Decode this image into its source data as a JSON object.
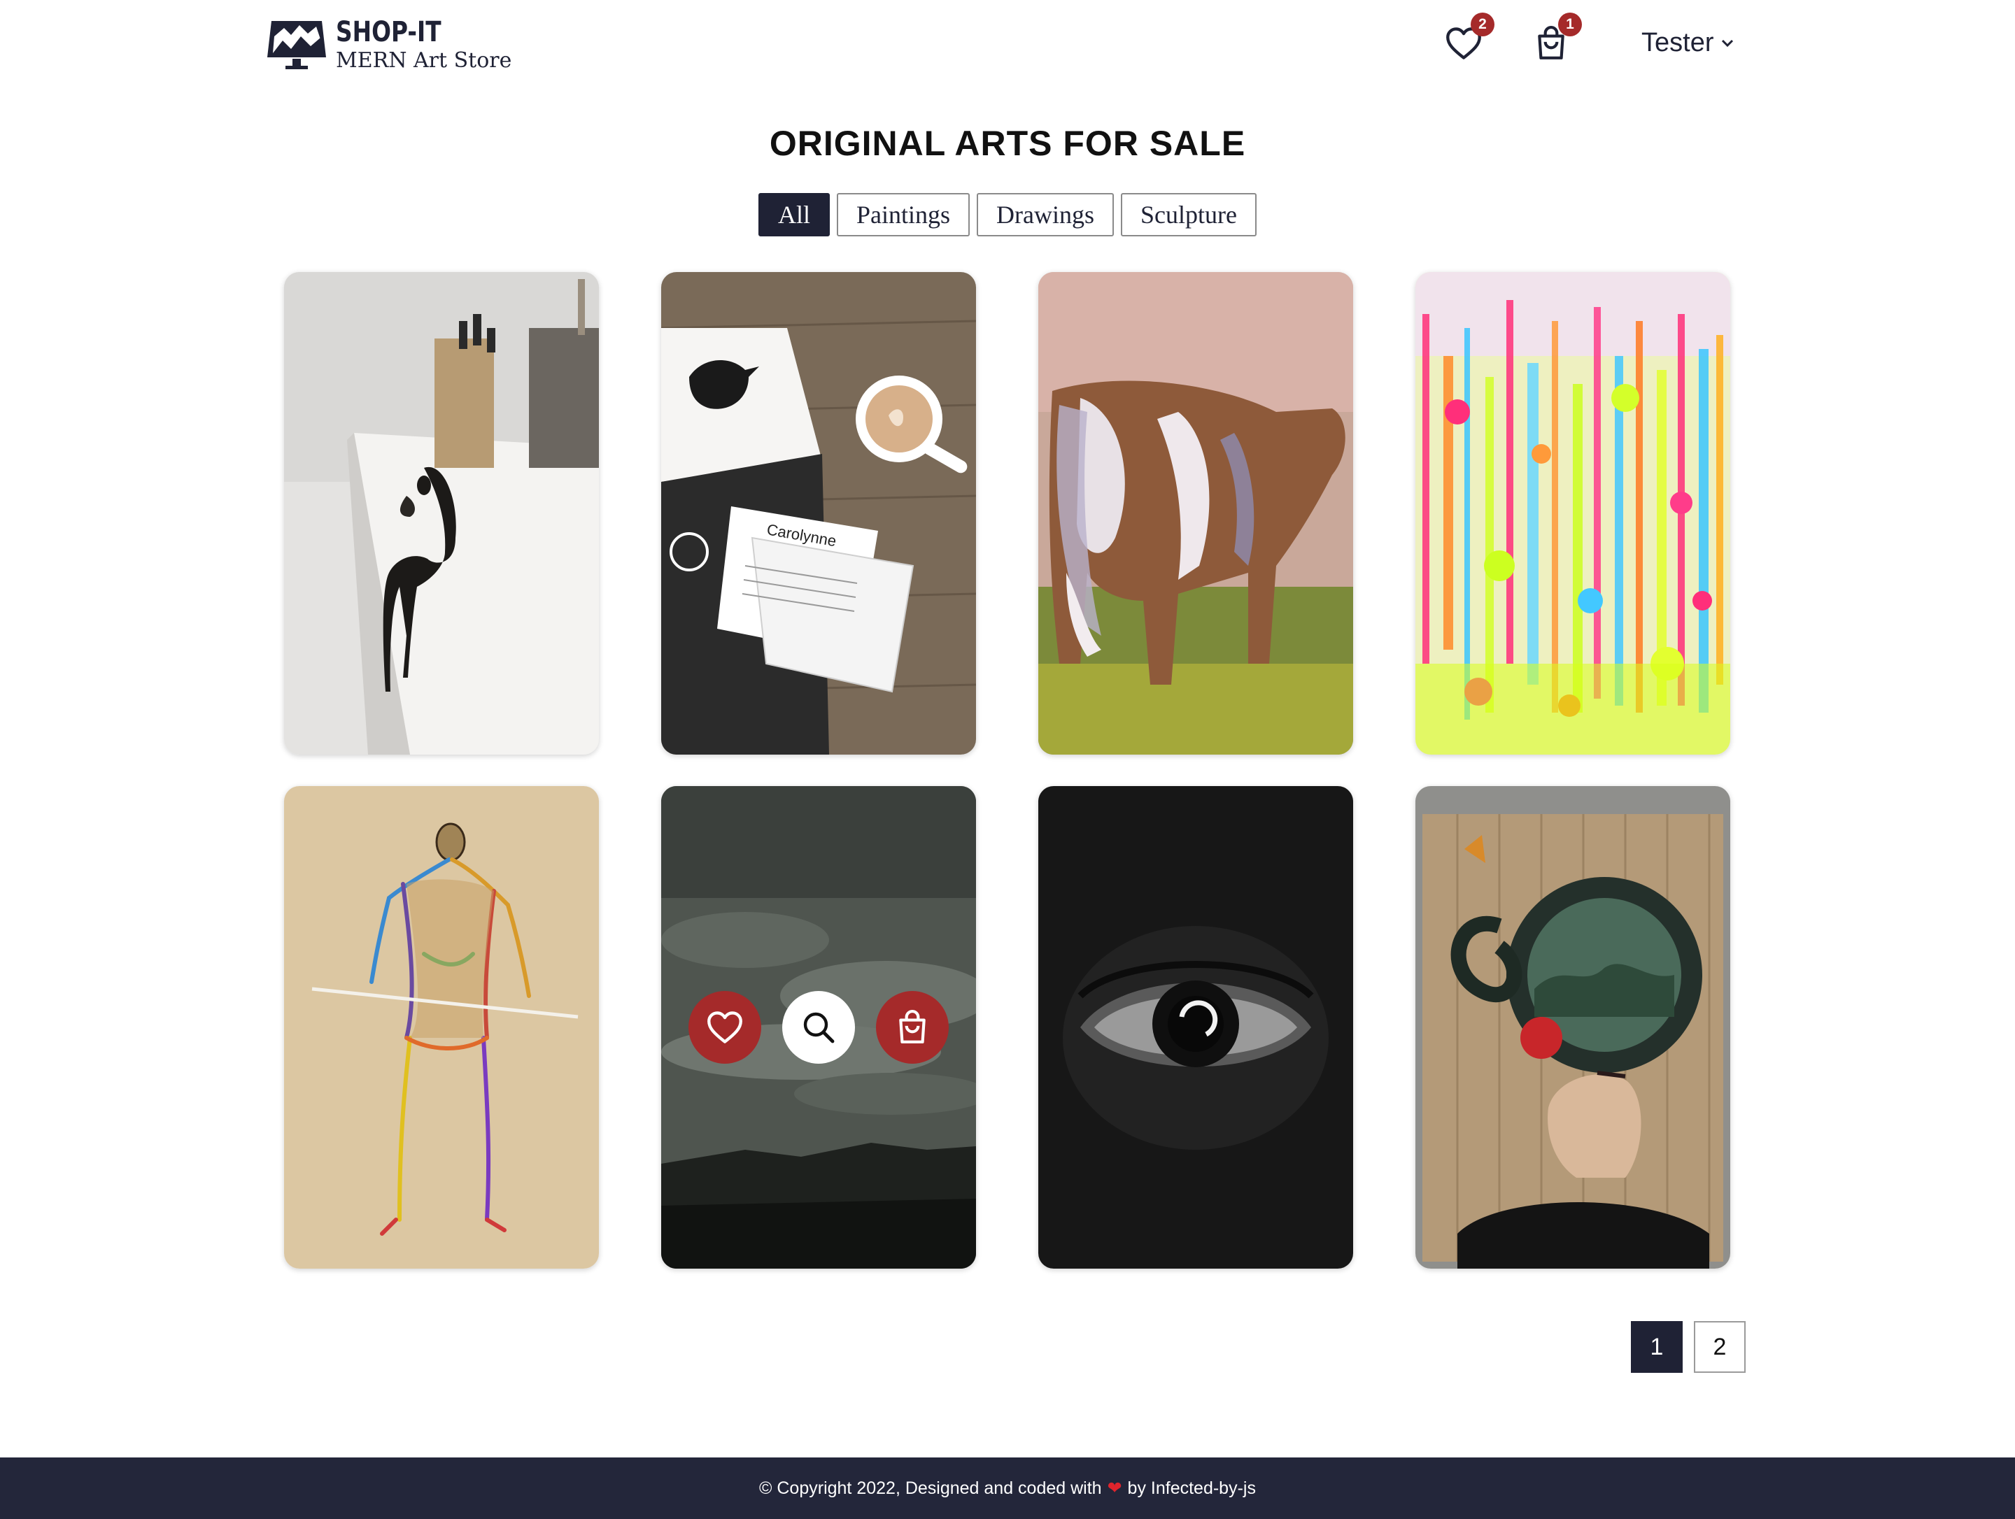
{
  "brand": {
    "name": "SHOP-IT",
    "tagline": "MERN Art Store"
  },
  "header": {
    "wishlist_count": "2",
    "cart_count": "1",
    "user_name": "Tester",
    "icons": [
      "heart-icon",
      "shopping-bag-icon",
      "chevron-down-icon"
    ]
  },
  "page_title": "ORIGINAL ARTS FOR SALE",
  "filters": [
    {
      "label": "All",
      "active": true
    },
    {
      "label": "Paintings",
      "active": false
    },
    {
      "label": "Drawings",
      "active": false
    },
    {
      "label": "Sculpture",
      "active": false
    }
  ],
  "products": [
    {
      "image": "bronze-figure-with-cat-sculpture"
    },
    {
      "image": "bird-print-with-certificate-and-coffee"
    },
    {
      "image": "cow-in-field-painting"
    },
    {
      "image": "neon-abstract-splatter-painting"
    },
    {
      "image": "colorful-figure-drawing"
    },
    {
      "image": "stormy-sky-monochrome-painting",
      "hovered": true
    },
    {
      "image": "dark-eye-closeup-painting"
    },
    {
      "image": "woman-with-landscape-helmet-collage"
    }
  ],
  "card_actions": [
    "heart-icon",
    "search-icon",
    "shopping-bag-icon"
  ],
  "pagination": {
    "pages": [
      "1",
      "2"
    ],
    "current": "1"
  },
  "footer": {
    "text_before": "© Copyright 2022, Designed and coded with",
    "heart": "❤",
    "text_after": "by Infected-by-js"
  },
  "colors": {
    "navy": "#1f2235",
    "accent_red": "#a52a2a",
    "footer_bg": "#23263a"
  }
}
